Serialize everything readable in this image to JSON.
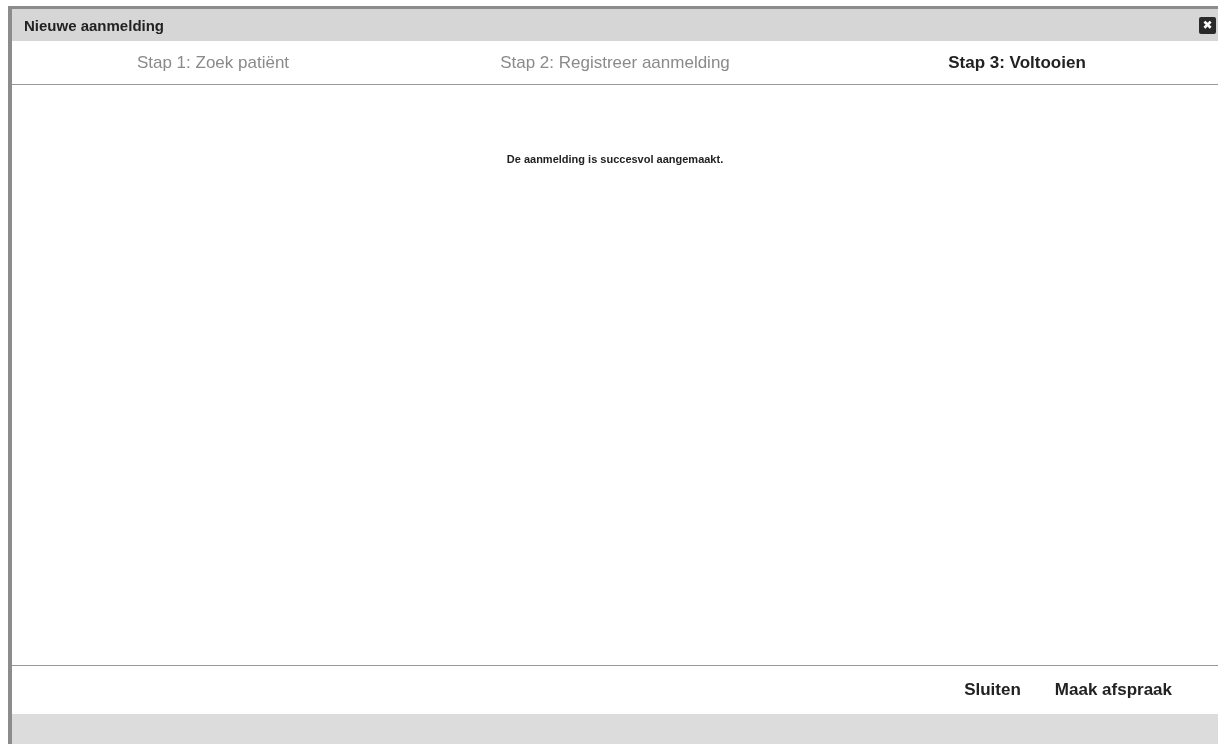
{
  "window": {
    "title": "Nieuwe aanmelding",
    "close": "✖"
  },
  "steps": [
    {
      "label": "Stap 1: Zoek patiënt",
      "selected": false
    },
    {
      "label": "Stap 2: Registreer aanmelding",
      "selected": false
    },
    {
      "label": "Stap 3: Voltooien",
      "selected": true
    }
  ],
  "message": "De aanmelding is succesvol aangemaakt.",
  "buttons": [
    "Sluiten",
    "Maak afspraak"
  ]
}
